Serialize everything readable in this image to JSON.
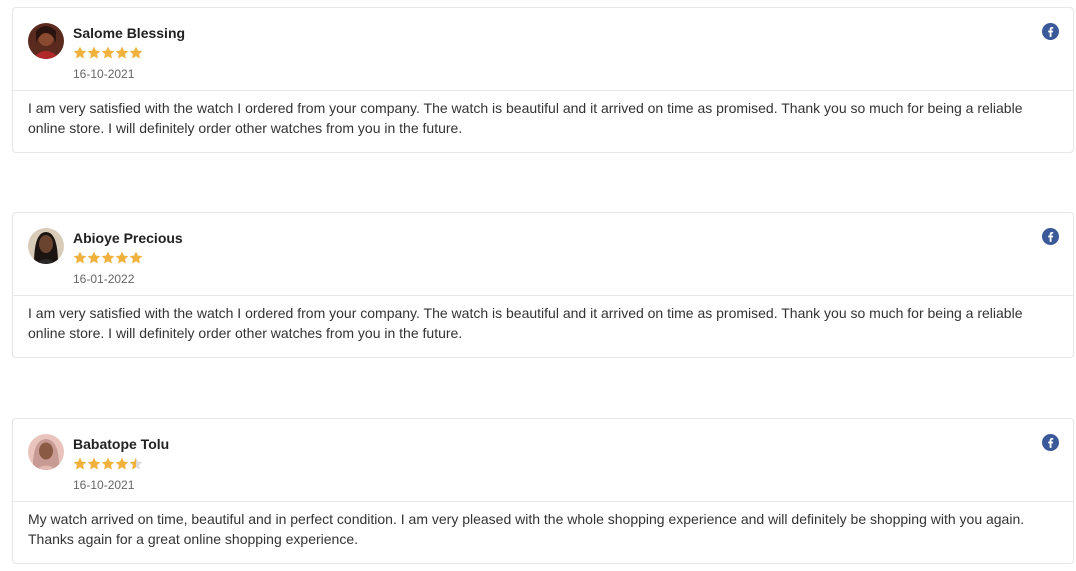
{
  "colors": {
    "star": "#f0b23c",
    "facebook": "#3b5998",
    "border": "#e6e6e6"
  },
  "reviews": [
    {
      "name": "Salome Blessing",
      "rating": 5,
      "date": "16-10-2021",
      "text": "I am very satisfied with the watch I ordered from your company. The watch is beautiful and it arrived on time as promised. Thank you so much for being a reliable online store. I will definitely order other watches from you in the future.",
      "source_icon": "facebook-icon"
    },
    {
      "name": "Abioye Precious",
      "rating": 5,
      "date": "16-01-2022",
      "text": "I am very satisfied with the watch I ordered from your company. The watch is beautiful and it arrived on time as promised. Thank you so much for being a reliable online store. I will definitely order other watches from you in the future.",
      "source_icon": "facebook-icon"
    },
    {
      "name": "Babatope Tolu",
      "rating": 4.5,
      "date": "16-10-2021",
      "text": "My watch arrived on time, beautiful and in perfect condition. I am very pleased with the whole shopping experience and will definitely be shopping with you again. Thanks again for a great online shopping experience.",
      "source_icon": "facebook-icon"
    }
  ]
}
